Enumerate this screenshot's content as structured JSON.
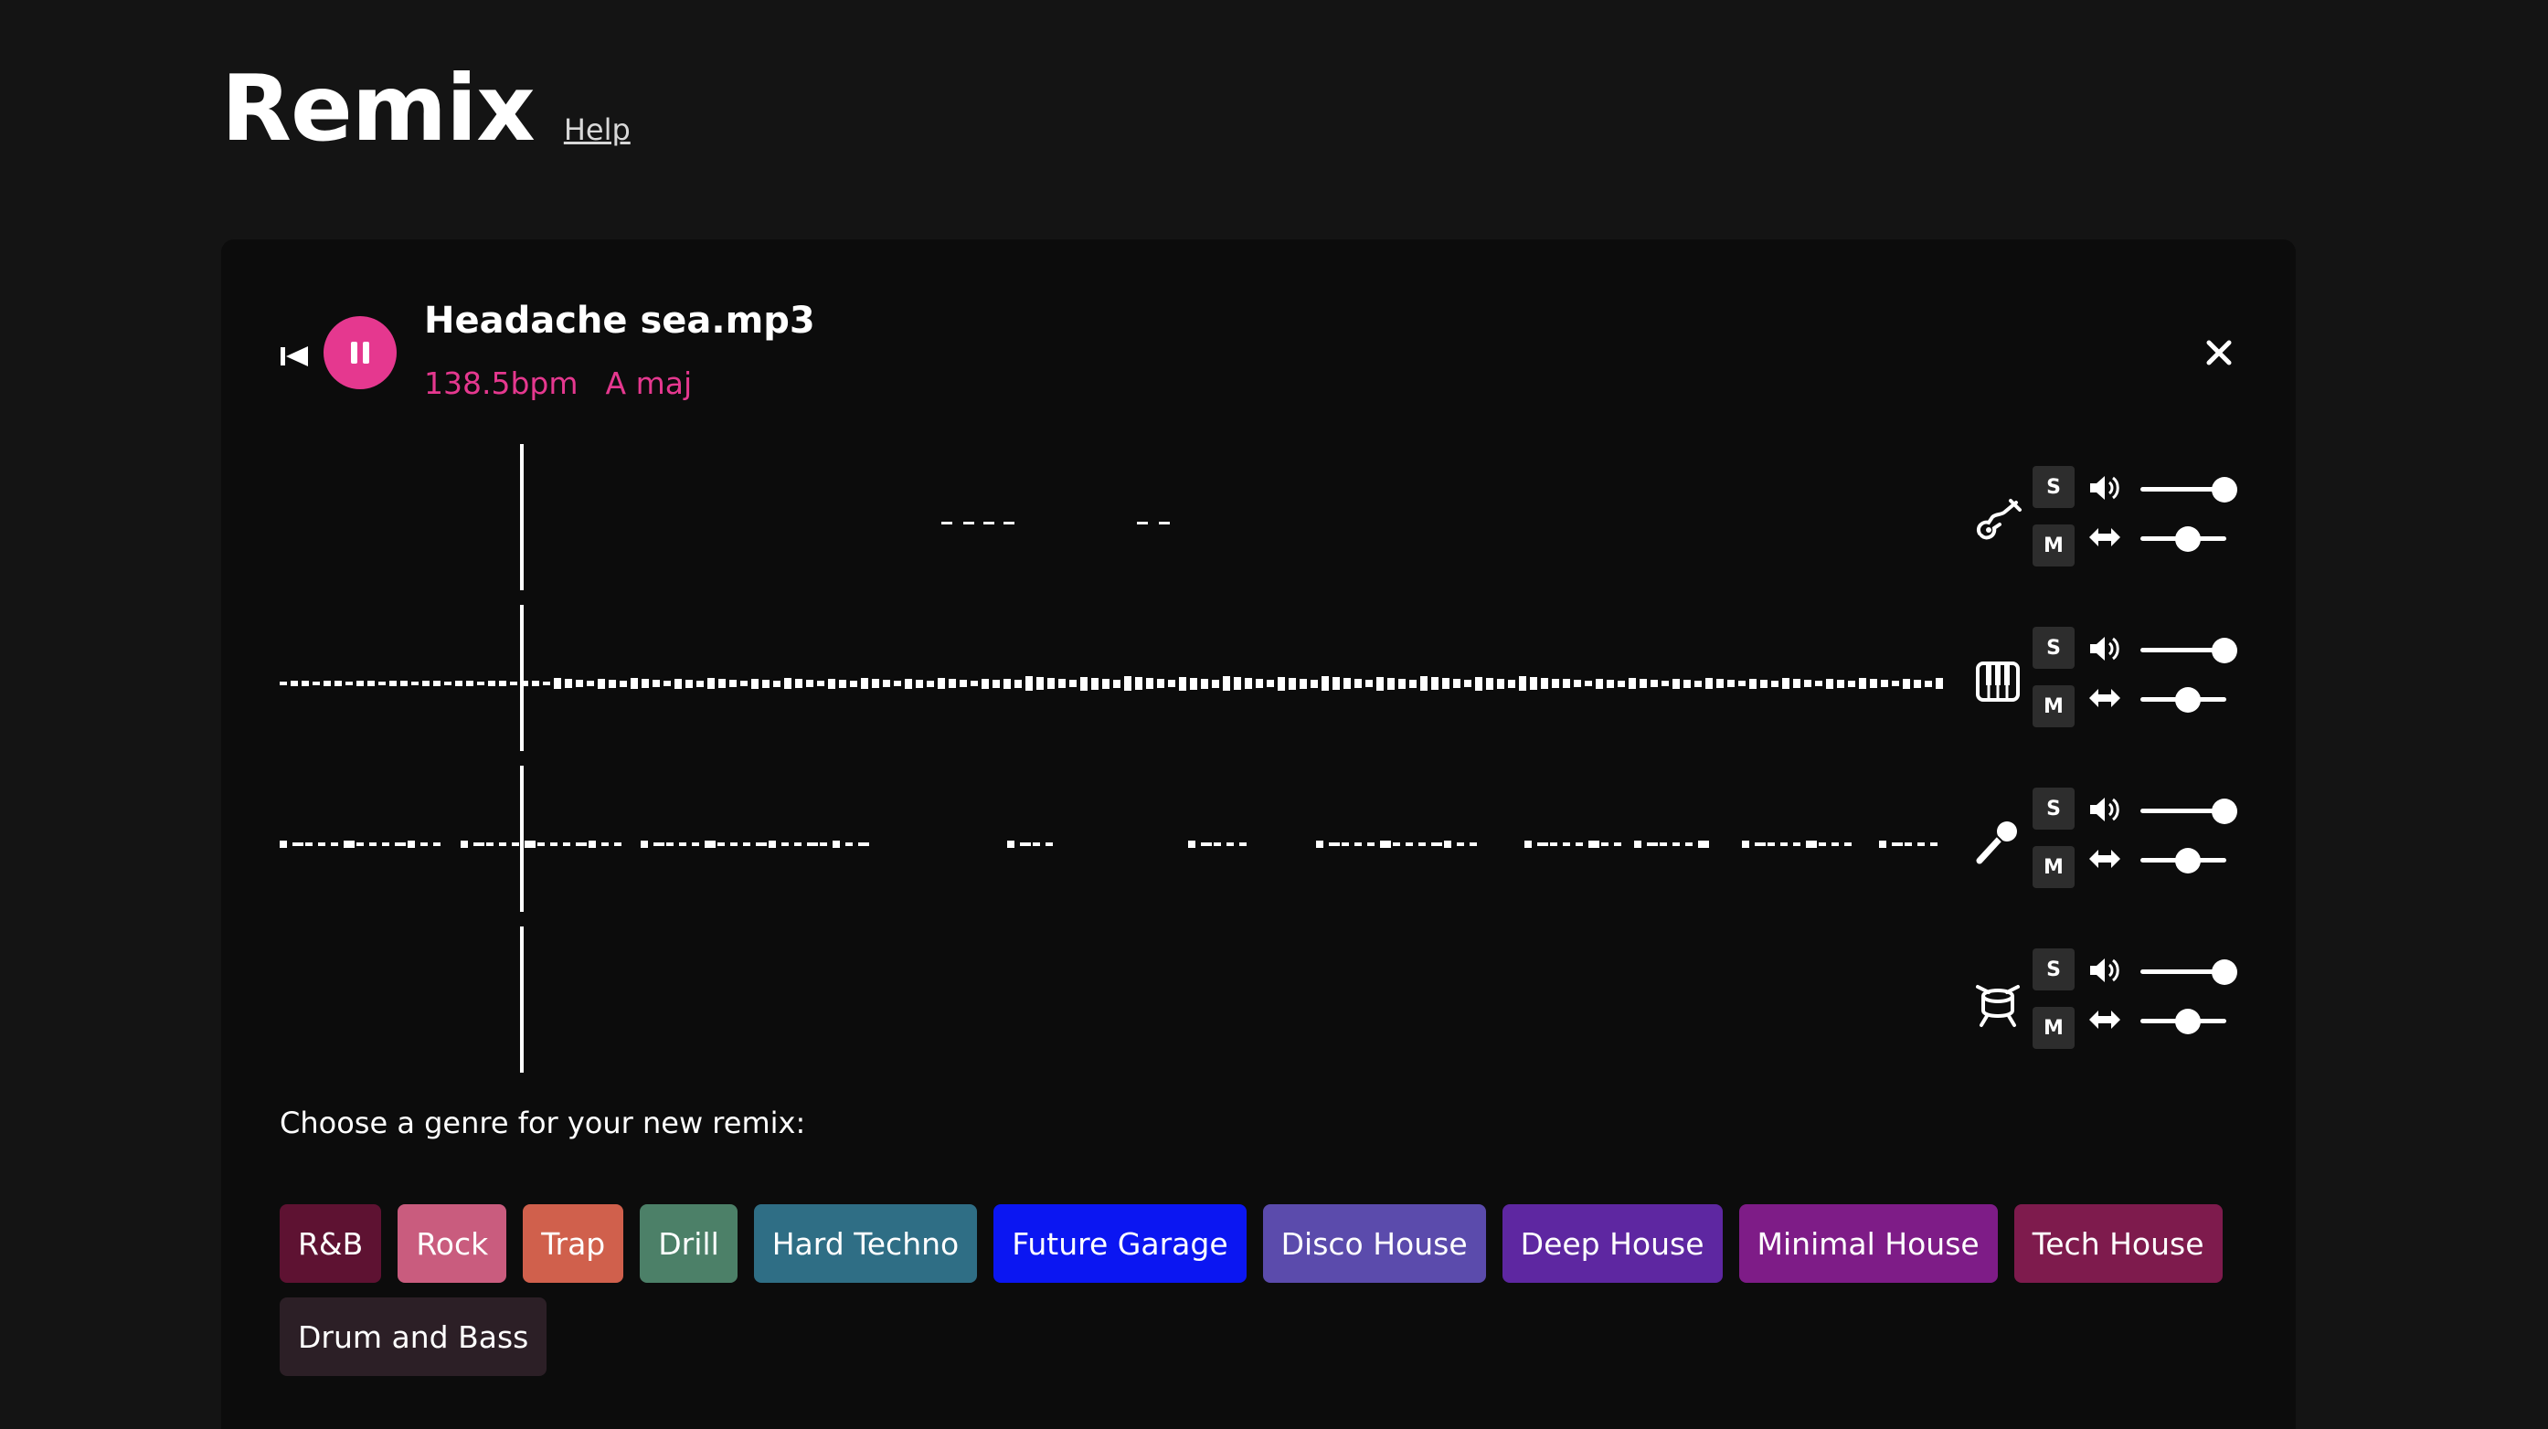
{
  "app": {
    "title": "Remix",
    "help_label": "Help"
  },
  "track": {
    "filename": "Headache sea.mp3",
    "bpm": "138.5bpm",
    "key": "A maj"
  },
  "playback": {
    "position": 0.145
  },
  "stems": [
    {
      "name": "guitar",
      "icon": "guitar-icon",
      "solo_label": "S",
      "mute_label": "M",
      "volume": 1.0,
      "pan": 0.5
    },
    {
      "name": "piano",
      "icon": "piano-icon",
      "solo_label": "S",
      "mute_label": "M",
      "volume": 1.0,
      "pan": 0.5
    },
    {
      "name": "vocals",
      "icon": "microphone-icon",
      "solo_label": "S",
      "mute_label": "M",
      "volume": 1.0,
      "pan": 0.5
    },
    {
      "name": "drums",
      "icon": "drum-icon",
      "solo_label": "S",
      "mute_label": "M",
      "volume": 1.0,
      "pan": 0.5
    }
  ],
  "genre_prompt": "Choose a genre for your new remix:",
  "genres": [
    {
      "label": "R&B",
      "color": "#5e1232"
    },
    {
      "label": "Rock",
      "color": "#c95c7e"
    },
    {
      "label": "Trap",
      "color": "#d0604c"
    },
    {
      "label": "Drill",
      "color": "#4c8068"
    },
    {
      "label": "Hard Techno",
      "color": "#2f6e85"
    },
    {
      "label": "Future Garage",
      "color": "#0b16f2"
    },
    {
      "label": "Disco House",
      "color": "#5b4bac"
    },
    {
      "label": "Deep House",
      "color": "#5e27a1"
    },
    {
      "label": "Minimal House",
      "color": "#7e1c87"
    },
    {
      "label": "Tech House",
      "color": "#7e1b4d"
    },
    {
      "label": "Drum and Bass",
      "color": "#2c1f26"
    }
  ],
  "colors": {
    "accent": "#e5388f",
    "background": "#141414",
    "card": "#0c0c0c"
  }
}
